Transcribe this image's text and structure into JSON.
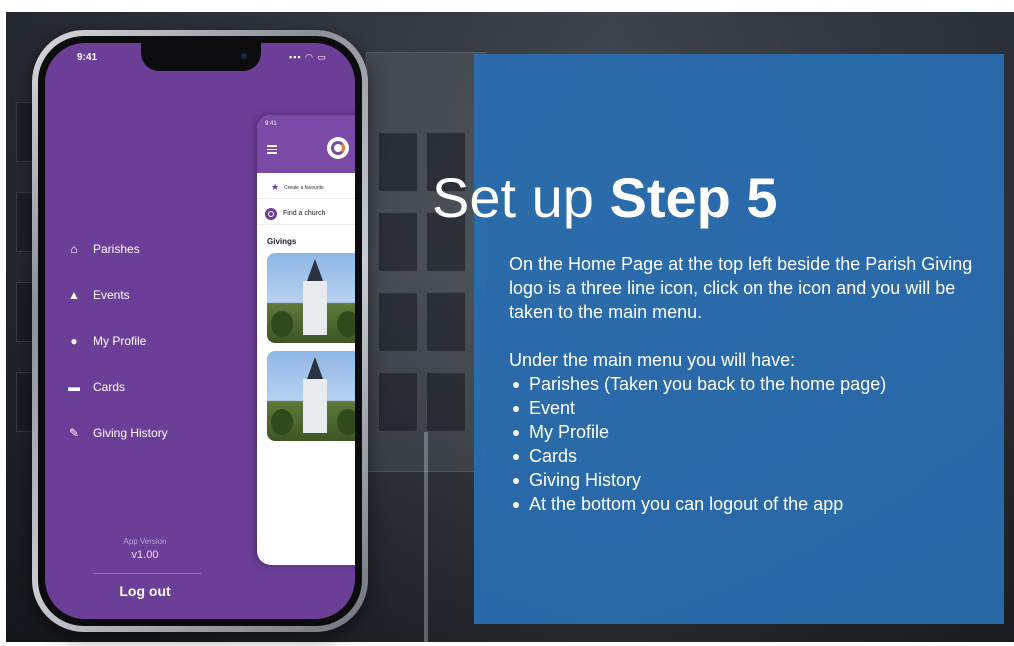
{
  "slide": {
    "title_prefix": "Set up ",
    "title_bold": "Step 5",
    "intro": "On the Home Page at the top left beside the Parish Giving logo is a three line icon, click on the icon and you will be taken to the main menu.",
    "list_heading": "Under the main menu you will have:",
    "bullets": [
      "Parishes (Taken you back to the home page)",
      "Event",
      "My Profile",
      "Cards",
      "Giving History",
      "At the bottom you can logout of the app"
    ],
    "panel_color": "#296eb2"
  },
  "phone": {
    "status_time": "9:41",
    "status_icons": "▪▪▪ ◠ ▭",
    "menu_color": "#6b3e98",
    "menu": [
      {
        "label": "Parishes",
        "icon": "home-icon",
        "glyph": "⌂"
      },
      {
        "label": "Events",
        "icon": "events-icon",
        "glyph": "▲"
      },
      {
        "label": "My Profile",
        "icon": "profile-icon",
        "glyph": "●"
      },
      {
        "label": "Cards",
        "icon": "cards-icon",
        "glyph": "▬"
      },
      {
        "label": "Giving History",
        "icon": "giving-history-icon",
        "glyph": "✎"
      }
    ],
    "app_version_label": "App Version",
    "app_version": "v1.00",
    "logout_label": "Log out",
    "mini_app": {
      "time": "9:41",
      "favourite_text": "Create a favourite",
      "find_text": "Find a church",
      "section_title": "Givings"
    }
  }
}
